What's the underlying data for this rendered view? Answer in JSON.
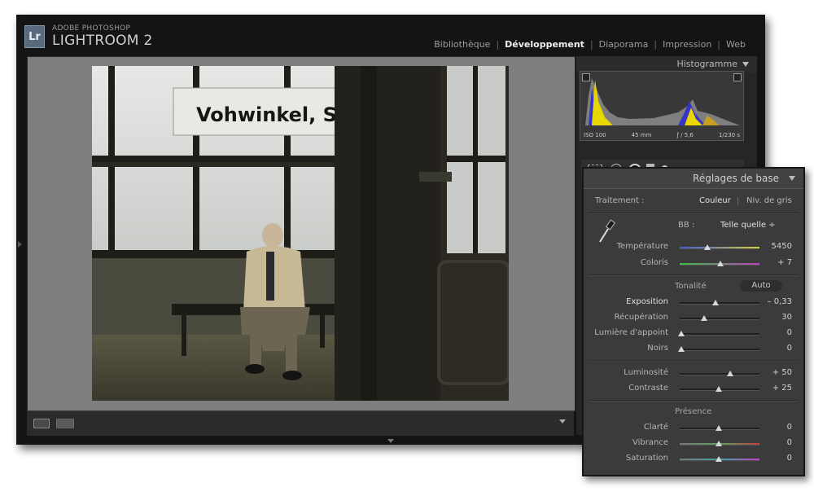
{
  "app": {
    "brand_small": "ADOBE PHOTOSHOP",
    "brand_big": "LIGHTROOM 2",
    "logo": "Lr"
  },
  "modules": [
    {
      "label": "Bibliothèque",
      "active": false
    },
    {
      "label": "Développement",
      "active": true
    },
    {
      "label": "Diaporama",
      "active": false
    },
    {
      "label": "Impression",
      "active": false
    },
    {
      "label": "Web",
      "active": false
    }
  ],
  "photo": {
    "sign_text": "Vohwinkel, Sch"
  },
  "histogram": {
    "title": "Histogramme",
    "iso": "ISO 100",
    "focal": "45 mm",
    "aperture": "ƒ / 5,6",
    "shutter": "1/230 s"
  },
  "basic": {
    "title": "Réglages de base",
    "treatment_label": "Traitement :",
    "treatment_color": "Couleur",
    "treatment_sep": "|",
    "treatment_gray": "Niv. de gris",
    "wb_label": "BB :",
    "wb_value": "Telle quelle ÷",
    "temp_label": "Température",
    "temp_value": "5450",
    "tint_label": "Coloris",
    "tint_value": "+ 7",
    "tone_title": "Tonalité",
    "auto_label": "Auto",
    "exposure_label": "Exposition",
    "exposure_value": "– 0,33",
    "recovery_label": "Récupération",
    "recovery_value": "30",
    "fill_label": "Lumière d'appoint",
    "fill_value": "0",
    "blacks_label": "Noirs",
    "blacks_value": "0",
    "brightness_label": "Luminosité",
    "brightness_value": "+ 50",
    "contrast_label": "Contraste",
    "contrast_value": "+ 25",
    "presence_title": "Présence",
    "clarity_label": "Clarté",
    "clarity_value": "0",
    "vibrance_label": "Vibrance",
    "vibrance_value": "0",
    "saturation_label": "Saturation",
    "saturation_value": "0"
  },
  "colors": {
    "accent_active": "#f0f0f0",
    "panel_bg": "#3b3b3b"
  }
}
